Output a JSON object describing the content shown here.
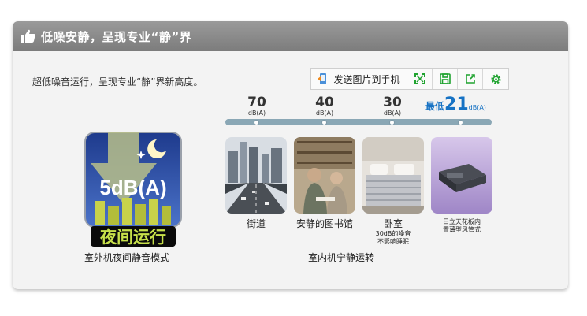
{
  "header": {
    "title": "低噪安静，呈现专业“静”界",
    "icon": "thumbs-up-icon"
  },
  "intro": "超低噪音运行，呈现专业“静”界新高度。",
  "toolbar": {
    "send_label": "发送图片到手机",
    "icons": [
      "phone-send-icon",
      "fullscreen-icon",
      "save-icon",
      "share-icon",
      "settings-icon"
    ],
    "accent_color": "#1fa32f"
  },
  "timeline": {
    "levels": [
      {
        "value": "70",
        "unit": "dB(A)",
        "caption": "街道"
      },
      {
        "value": "40",
        "unit": "dB(A)",
        "caption": "安静的图书馆"
      },
      {
        "value": "30",
        "unit": "dB(A)",
        "caption": "卧室",
        "note_line1": "30dB的噪音",
        "note_line2": "不影响睡眠"
      }
    ],
    "best": {
      "prefix": "最低",
      "value": "21",
      "unit": "dB(A)",
      "caption_line1": "日立天花板内",
      "caption_line2": "置薄型风管式",
      "color": "#1672c4"
    }
  },
  "outdoor": {
    "badge_value": "5dB(A)",
    "badge_text": "夜间运行",
    "label": "室外机夜间静音模式"
  },
  "indoor": {
    "label": "室内机宁静运转"
  }
}
